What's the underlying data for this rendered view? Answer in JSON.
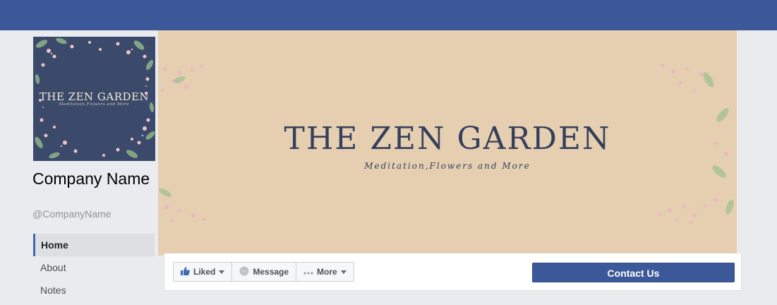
{
  "colors": {
    "topbar": "#3b5998",
    "cover_bg": "#e6cfb1",
    "navy": "#36405c",
    "accent": "#4267b2"
  },
  "profile": {
    "name": "Company Name",
    "handle": "@CompanyName",
    "pic_title": "THE ZEN GARDEN",
    "pic_subtitle": "Meditation,Flowers and More"
  },
  "nav": {
    "items": [
      {
        "label": "Home",
        "active": true
      },
      {
        "label": "About",
        "active": false
      },
      {
        "label": "Notes",
        "active": false
      }
    ]
  },
  "cover": {
    "title": "THE ZEN GARDEN",
    "subtitle": "Meditation,Flowers and More"
  },
  "actions": {
    "liked_label": "Liked",
    "message_label": "Message",
    "more_label": "More",
    "contact_label": "Contact Us"
  },
  "icons": {
    "liked": "thumbs-up-icon",
    "message": "messenger-icon",
    "more": "more-dots-icon"
  }
}
